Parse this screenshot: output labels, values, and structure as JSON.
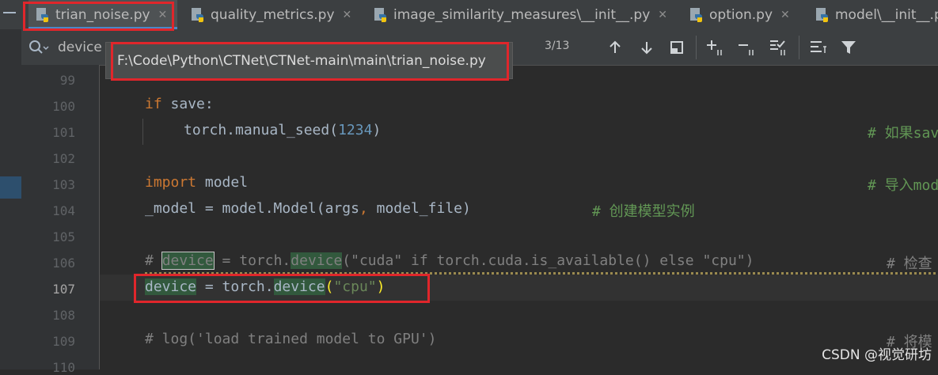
{
  "tabs": [
    {
      "label": "trian_noise.py",
      "icon": "python-file-icon",
      "active": true
    },
    {
      "label": "quality_metrics.py",
      "icon": "python-file-icon",
      "active": false
    },
    {
      "label": "image_similarity_measures\\__init__.py",
      "icon": "python-file-icon",
      "active": false
    },
    {
      "label": "option.py",
      "icon": "python-file-icon",
      "active": false
    },
    {
      "label": "model\\__init__.py",
      "icon": "python-file-icon",
      "active": false
    }
  ],
  "search": {
    "value": "device",
    "match_count": "3/13"
  },
  "tooltip": {
    "path": "F:\\Code\\Python\\CTNet\\CTNet-main\\main\\trian_noise.py"
  },
  "line_numbers": [
    "99",
    "100",
    "101",
    "102",
    "103",
    "104",
    "105",
    "106",
    "107",
    "108",
    "109",
    "110"
  ],
  "current_line": "107",
  "code": {
    "l100_kw": "if",
    "l100_rest": " save:",
    "l101_a": "torch.manual_seed(",
    "l101_num": "1234",
    "l101_b": ")",
    "l101_cmt": "# 如果sav",
    "l103_kw": "import",
    "l103_rest": " model",
    "l103_cmt": "# 导入mod",
    "l104_a": "_model = model.Model(args",
    "l104_comma": ",",
    "l104_b": " model_file)",
    "l104_cmt": "# 创建模型实例",
    "l106_a": "# ",
    "l106_dev1": "device",
    "l106_b": " = torch.",
    "l106_dev2": "device",
    "l106_c": "(\"cuda\" if torch.cuda.is_available() else \"cpu\")",
    "l106_cmt": "# 检查",
    "l107_dev1": "device",
    "l107_b": " = torch.",
    "l107_dev2": "device",
    "l107_p1": "(",
    "l107_str": "\"cpu\"",
    "l107_p2": ")",
    "l109_cmt": "# log('load trained model to GPU')",
    "l109_cmt2": "# 将模"
  },
  "watermark": "CSDN @视觉研坊",
  "colors": {
    "annotation_red": "#e0262b",
    "keyword": "#cc7832",
    "string": "#6a8759",
    "number": "#6897bb",
    "comment": "#629755"
  }
}
